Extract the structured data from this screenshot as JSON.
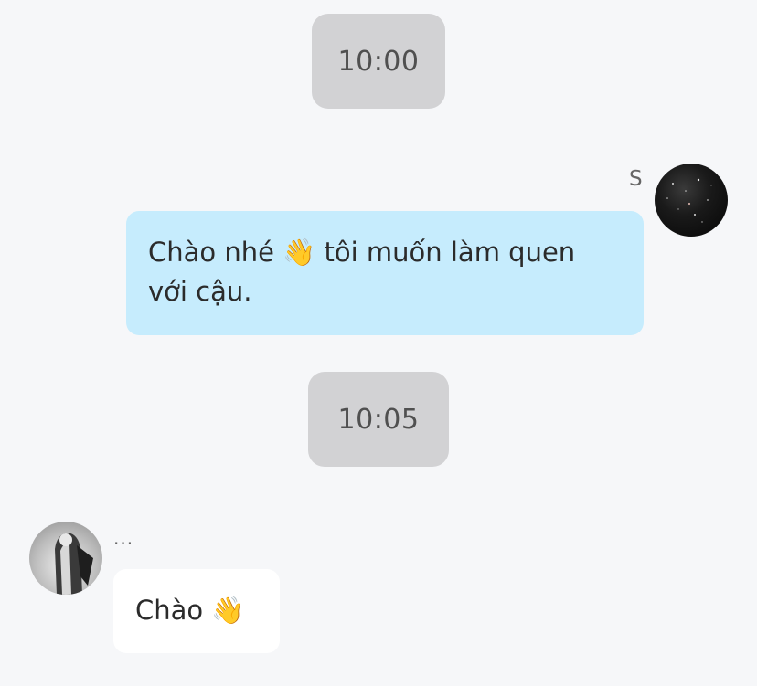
{
  "chat": {
    "timestamps": [
      "10:00",
      "10:05"
    ],
    "messages": [
      {
        "direction": "outgoing",
        "sender_label": "S",
        "text": "Chào nhé 👋 tôi muốn làm quen với cậu.",
        "bubble_color": "#c6ecfd"
      },
      {
        "direction": "incoming",
        "sender_label": "...",
        "text": "Chào 👋",
        "bubble_color": "#ffffff"
      }
    ]
  },
  "colors": {
    "background": "#f6f7f9",
    "timestamp_pill": "#d2d2d4"
  }
}
